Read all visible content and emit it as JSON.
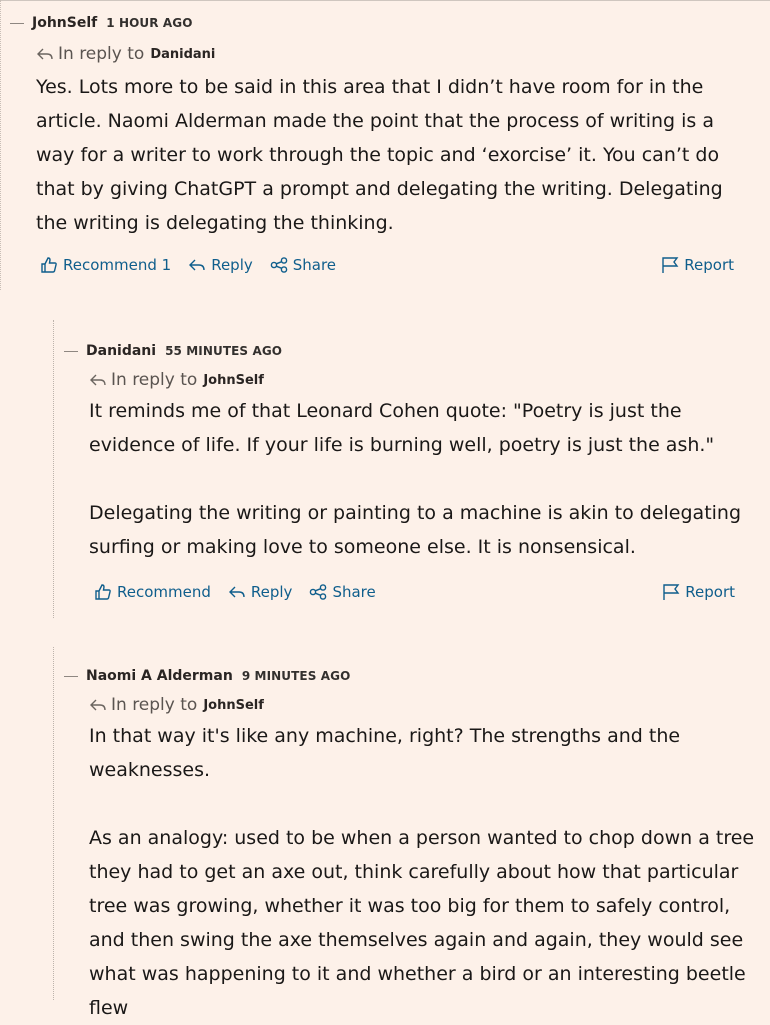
{
  "colors": {
    "background": "#fdf1e9",
    "link": "#0f5e8c",
    "text": "#1a1817"
  },
  "comments": [
    {
      "author": "JohnSelf",
      "time": "1 HOUR AGO",
      "reply_label": "In reply to",
      "reply_to": "Danidani",
      "paragraphs": [
        "Yes. Lots more to be said in this area that I didn’t have room for in the article. Naomi Alderman made the point that the process of writing is a way for a writer to work through the topic and ‘exorcise’ it. You can’t do that by giving ChatGPT a prompt and delegating the writing. Delegating the writing is delegating the thinking."
      ],
      "actions": {
        "recommend": "Recommend 1",
        "reply": "Reply",
        "share": "Share",
        "report": "Report"
      }
    },
    {
      "author": "Danidani",
      "time": "55 MINUTES AGO",
      "reply_label": "In reply to",
      "reply_to": "JohnSelf",
      "paragraphs": [
        "It reminds me of that Leonard Cohen quote: \"Poetry is just the evidence of life. If your life is burning well, poetry is just the ash.\"",
        "Delegating the writing or painting to a machine is akin to delegating surfing or making love to someone else. It is nonsensical."
      ],
      "actions": {
        "recommend": "Recommend",
        "reply": "Reply",
        "share": "Share",
        "report": "Report"
      }
    },
    {
      "author": "Naomi A Alderman",
      "time": "9 MINUTES AGO",
      "reply_label": "In reply to",
      "reply_to": "JohnSelf",
      "paragraphs": [
        "In that way it's like any machine, right? The strengths and the weaknesses.",
        "As an analogy: used to be when a person wanted to chop down a tree they had to get an axe out, think carefully about how that particular tree was growing, whether it was too big for them to safely control, and then swing the axe themselves again and again, they would see what was happening to it and whether a bird or an interesting beetle flew"
      ]
    }
  ]
}
